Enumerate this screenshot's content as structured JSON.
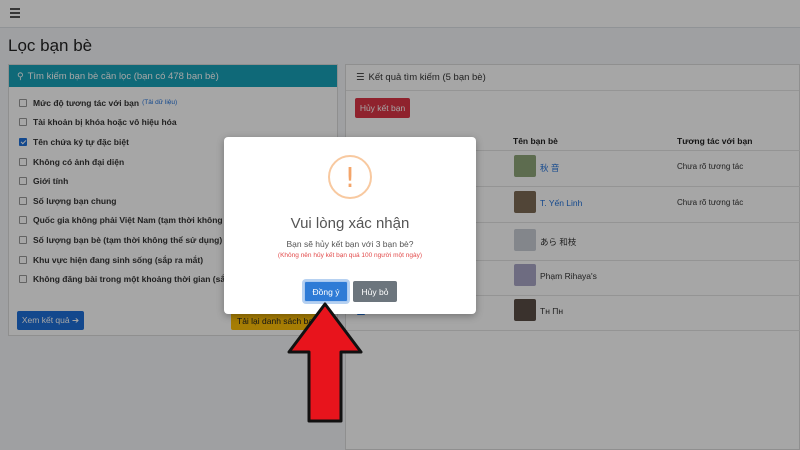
{
  "page": {
    "title": "Lọc bạn bè"
  },
  "filter_card": {
    "header": "Tìm kiếm bạn bè cần lọc (bạn có 478 bạn bè)",
    "items": [
      {
        "label": "Mức độ tương tác với bạn",
        "note": "(Tải dữ liệu)",
        "checked": false
      },
      {
        "label": "Tài khoản bị khóa hoặc vô hiệu hóa",
        "note": "",
        "checked": false
      },
      {
        "label": "Tên chứa ký tự đặc biệt",
        "note": "",
        "checked": true
      },
      {
        "label": "Không có ảnh đại diện",
        "note": "",
        "checked": false
      },
      {
        "label": "Giới tính",
        "note": "",
        "checked": false
      },
      {
        "label": "Số lượng bạn chung",
        "note": "",
        "checked": false
      },
      {
        "label": "Quốc gia không phải Việt Nam (tạm thời không thể sử dụng)",
        "note": "",
        "checked": false
      },
      {
        "label": "Số lượng bạn bè (tạm thời không thể sử dụng)",
        "note": "",
        "checked": false
      },
      {
        "label": "Khu vực hiện đang sinh sống (sắp ra mắt)",
        "note": "",
        "checked": false
      },
      {
        "label": "Không đăng bài trong một khoảng thời gian (sắp ra mắt)",
        "note": "",
        "checked": false
      }
    ],
    "view_button": "Xem kết quả ➔",
    "reload_button": "Tải lại danh sách bạn bè"
  },
  "results_card": {
    "header": "Kết quả tìm kiếm (5 bạn bè)",
    "unfriend_button": "Hủy kết bạn",
    "columns": {
      "name": "Tên bạn bè",
      "interaction": "Tương tác với bạn"
    },
    "rows": [
      {
        "name": "秋 音",
        "interaction": "Chưa rõ tương tác",
        "link": true,
        "avatar_color": "#8fa77a"
      },
      {
        "name": "T. Yến Linh",
        "interaction": "Chưa rõ tương tác",
        "link": true,
        "avatar_color": "#7d6a55"
      },
      {
        "name": "あら 和枝",
        "interaction": "",
        "link": false,
        "avatar_color": "#c9ced6"
      },
      {
        "name": "Phạm Rihaya's",
        "interaction": "",
        "link": false,
        "avatar_color": "#a9a6c6"
      },
      {
        "name": "Тн Пн",
        "interaction": "",
        "link": false,
        "avatar_color": "#5a4d45"
      }
    ]
  },
  "modal": {
    "icon": "!",
    "title": "Vui lòng xác nhận",
    "text": "Bạn sẽ hủy kết bạn với 3 bạn bè?",
    "note": "(Không nên hủy kết bạn quá 100 người một ngày)",
    "ok_button": "Đồng ý",
    "cancel_button": "Hủy bỏ"
  },
  "colors": {
    "accent": "#17a2b8",
    "primary": "#1e6fd9",
    "danger": "#dc3545",
    "warning": "#ffc107",
    "arrow": "#e8141c"
  }
}
